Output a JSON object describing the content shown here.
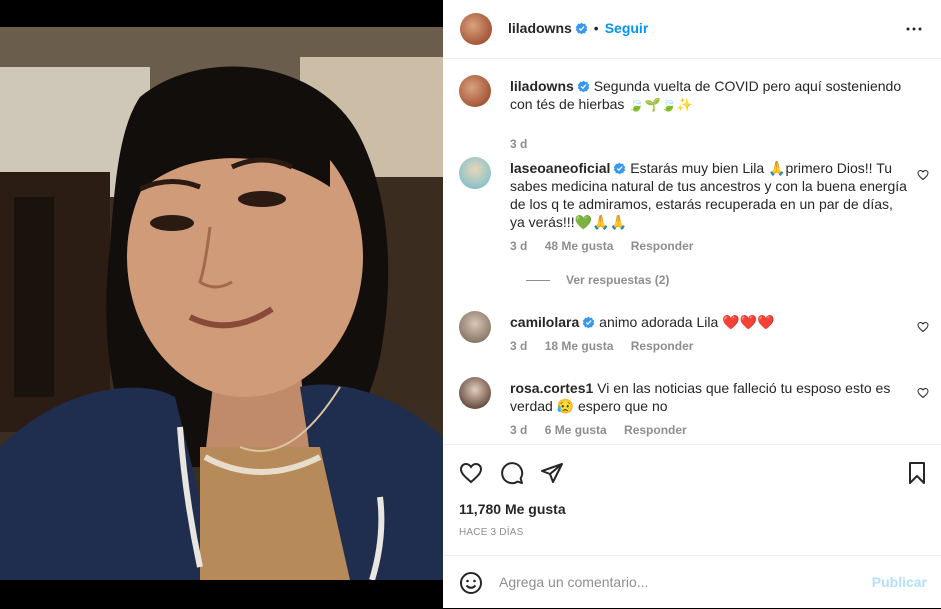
{
  "post": {
    "username": "liladowns",
    "follow_label": "Seguir",
    "separator": "•"
  },
  "caption": {
    "username": "liladowns",
    "text": "Segunda vuelta de COVID pero aquí sosteniendo con tés de hierbas",
    "emojis": "🍃🌱🍃✨",
    "time": "3 d"
  },
  "comments": [
    {
      "username": "laseoaneoficial",
      "text": "Estarás muy bien Lila 🙏primero Dios!! Tu sabes medicina natural de tus ancestros y con la buena energía de los q te admiramos, estarás recuperada en un par de días, ya verás!!!💚🙏🙏",
      "time": "3 d",
      "likes": "48 Me gusta",
      "reply": "Responder",
      "view_replies": "Ver respuestas (2)"
    },
    {
      "username": "camilolara",
      "text": "animo adorada Lila ❤️❤️❤️",
      "time": "3 d",
      "likes": "18 Me gusta",
      "reply": "Responder"
    },
    {
      "username": "rosa.cortes1",
      "text": "Vi en las noticias que falleció tu esposo esto es verdad 😥 espero que no",
      "time": "3 d",
      "likes": "6 Me gusta",
      "reply": "Responder"
    }
  ],
  "stats": {
    "likes": "11,780 Me gusta",
    "posted_ago": "HACE 3 DÍAS"
  },
  "composer": {
    "placeholder": "Agrega un comentario...",
    "publish_label": "Publicar"
  },
  "colors": {
    "link_blue": "#0095f6",
    "verified_blue": "#3897f0",
    "muted_text": "#8e8e8e",
    "publish_disabled": "#b2dffc"
  }
}
